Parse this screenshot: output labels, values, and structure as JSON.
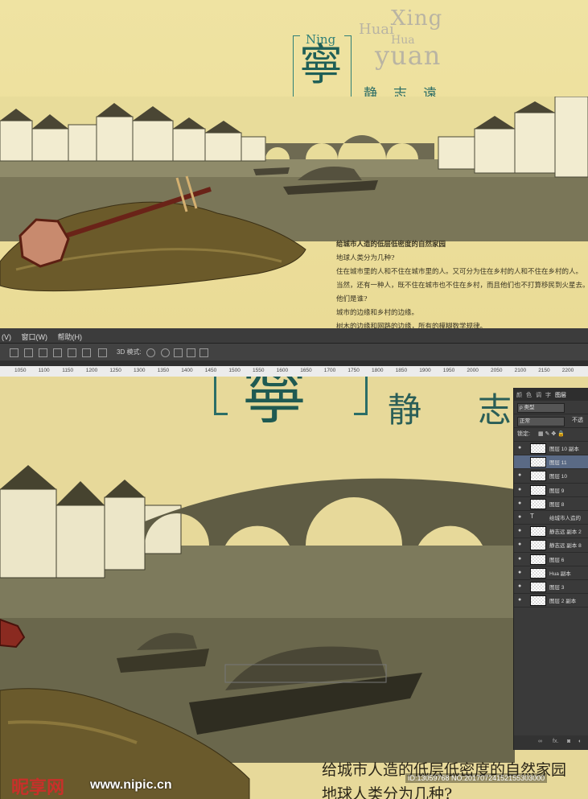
{
  "poster": {
    "latin": {
      "xing": "Xing",
      "huai": "Huai",
      "hua": "Hua",
      "yuan": "yuan",
      "ning": "Ning"
    },
    "big_char": "寧",
    "subtitle": "静志遠",
    "text_lines": [
      "给城市人造的低层低密度的自然家园",
      "地球人类分为几种?",
      "住在城市里的人和不住在城市里的人。又可分为住在乡村的人和不住在乡村的人。",
      "当然，还有一种人，既不住在城市也不住在乡村，而且他们也不打算移民到火星去。",
      "他们是谁?",
      "城市的边缘和乡村的边缘。",
      "树木的边缘和网路的边缘，所有的模糊数学规律。"
    ]
  },
  "menubar": {
    "items": [
      "(V)",
      "窗口(W)",
      "帮助(H)"
    ]
  },
  "optionsbar": {
    "mode_label": "3D 模式:"
  },
  "ruler": {
    "ticks": [
      "1050",
      "1100",
      "1150",
      "1200",
      "1250",
      "1300",
      "1350",
      "1400",
      "1450",
      "1500",
      "1550",
      "1600",
      "1650",
      "1700",
      "1750",
      "1800",
      "1850",
      "1900",
      "1950",
      "2000",
      "2050",
      "2100",
      "2150",
      "2200"
    ]
  },
  "canvas": {
    "big_char": "寧",
    "subtitle": "静志",
    "line1": "给城市人造的低层低密度的自然家园",
    "line2": "地球人类分为几种?"
  },
  "layers_panel": {
    "tabs": [
      "颜",
      "色",
      "调",
      "字",
      "图层"
    ],
    "filter_label": "ρ 类型",
    "blend_mode": "正常",
    "opacity_label": "不透",
    "lock_label": "锁定:",
    "layers": [
      {
        "name": "图层 10 副本",
        "active": false
      },
      {
        "name": "图层 11",
        "active": true
      },
      {
        "name": "图层 10",
        "active": false
      },
      {
        "name": "图层 9",
        "active": false
      },
      {
        "name": "图层 8",
        "active": false
      },
      {
        "name": "给城市人造的",
        "active": false,
        "type": "text"
      },
      {
        "name": "静志远 副本 2",
        "active": false
      },
      {
        "name": "静志远 副本 8",
        "active": false
      },
      {
        "name": "图层 6",
        "active": false
      },
      {
        "name": "Hua 副本",
        "active": false
      },
      {
        "name": "图层 3",
        "active": false
      },
      {
        "name": "图层 2 副本",
        "active": false
      }
    ]
  },
  "watermark": {
    "logo": "昵享网",
    "url": "www.nipic.cn",
    "id_text": "ID:13059768 NO:20170724152155303000"
  }
}
